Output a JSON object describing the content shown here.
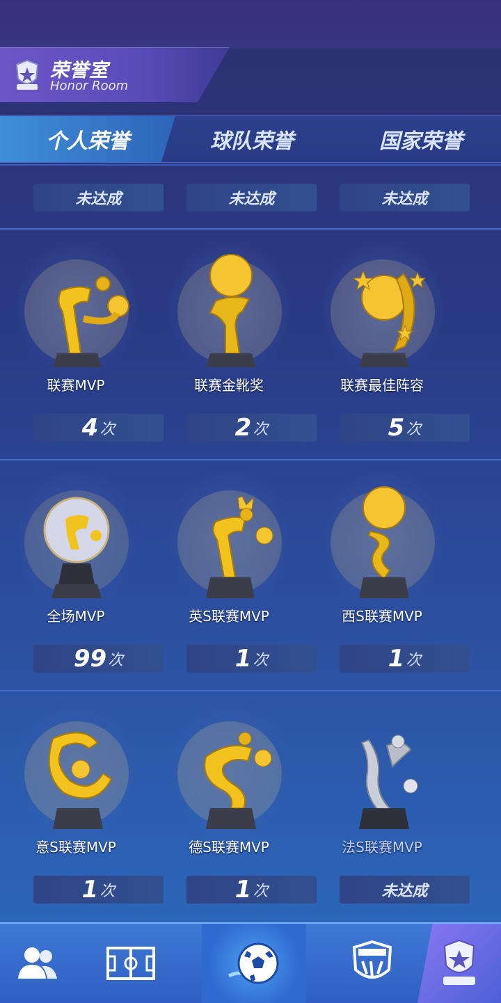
{
  "header": {
    "title": "荣誉室",
    "subtitle": "Honor Room",
    "emblem_icon": "trophy-emblem-icon"
  },
  "tabs": [
    {
      "label": "个人荣誉",
      "active": true
    },
    {
      "label": "球队荣誉",
      "active": false
    },
    {
      "label": "国家荣誉",
      "active": false
    }
  ],
  "top_status": [
    "未达成",
    "未达成",
    "未达成"
  ],
  "unit": "次",
  "trophies": [
    {
      "name": "联赛MVP",
      "count": "4",
      "achieved": true,
      "icon": "player-kick-trophy-icon"
    },
    {
      "name": "联赛金靴奖",
      "count": "2",
      "achieved": true,
      "icon": "golden-boot-trophy-icon"
    },
    {
      "name": "联赛最佳阵容",
      "count": "5",
      "achieved": true,
      "icon": "stars-ball-trophy-icon"
    },
    {
      "name": "全场MVP",
      "count": "99",
      "achieved": true,
      "icon": "crystal-ball-trophy-icon"
    },
    {
      "name": "英S联赛MVP",
      "count": "1",
      "achieved": true,
      "icon": "crown-player-trophy-icon"
    },
    {
      "name": "西S联赛MVP",
      "count": "1",
      "achieved": true,
      "icon": "ball-spiral-trophy-icon"
    },
    {
      "name": "意S联赛MVP",
      "count": "1",
      "achieved": true,
      "icon": "swirl-ball-trophy-icon"
    },
    {
      "name": "德S联赛MVP",
      "count": "1",
      "achieved": true,
      "icon": "player-ball-trophy-icon"
    },
    {
      "name": "法S联赛MVP",
      "count": "",
      "achieved": false,
      "status": "未达成",
      "icon": "silver-player-trophy-icon"
    }
  ],
  "bottom_nav": [
    {
      "icon": "players-icon",
      "active": false
    },
    {
      "icon": "field-icon",
      "active": false
    },
    {
      "icon": "football-icon",
      "active": false
    },
    {
      "icon": "club-shield-icon",
      "active": false
    },
    {
      "icon": "trophy-icon",
      "active": true
    }
  ],
  "colors": {
    "gold": "#f5c518",
    "silver": "#c9ced8",
    "active_tab": "#3f8fd8",
    "nav_active": "#8a78f0"
  }
}
